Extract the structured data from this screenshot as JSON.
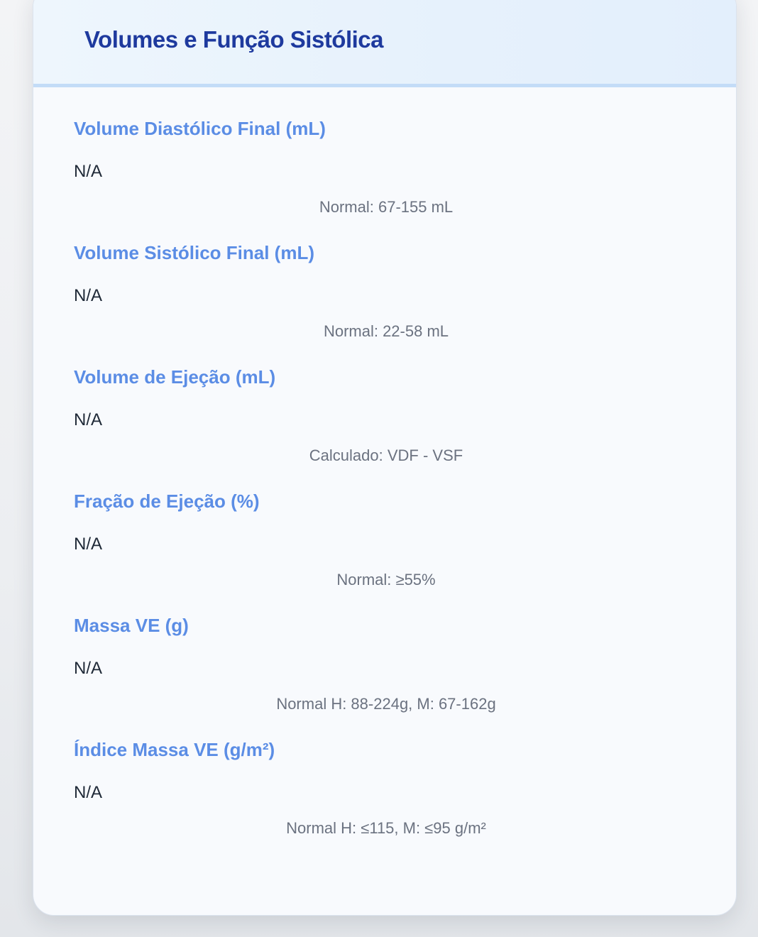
{
  "card": {
    "title": "Volumes e Função Sistólica"
  },
  "fields": [
    {
      "label": "Volume Diastólico Final (mL)",
      "value": "N/A",
      "hint": "Normal: 67-155 mL"
    },
    {
      "label": "Volume Sistólico Final (mL)",
      "value": "N/A",
      "hint": "Normal: 22-58 mL"
    },
    {
      "label": "Volume de Ejeção (mL)",
      "value": "N/A",
      "hint": "Calculado: VDF - VSF"
    },
    {
      "label": "Fração de Ejeção (%)",
      "value": "N/A",
      "hint": "Normal: ≥55%"
    },
    {
      "label": "Massa VE (g)",
      "value": "N/A",
      "hint": "Normal H: 88-224g, M: 67-162g"
    },
    {
      "label": "Índice Massa VE (g/m²)",
      "value": "N/A",
      "hint": "Normal H: ≤115, M: ≤95 g/m²"
    }
  ],
  "colors": {
    "title": "#1e3a9e",
    "label": "#5b8de5",
    "value": "#1f2937",
    "hint": "#6b7280",
    "header_border": "#c3dcf7"
  }
}
